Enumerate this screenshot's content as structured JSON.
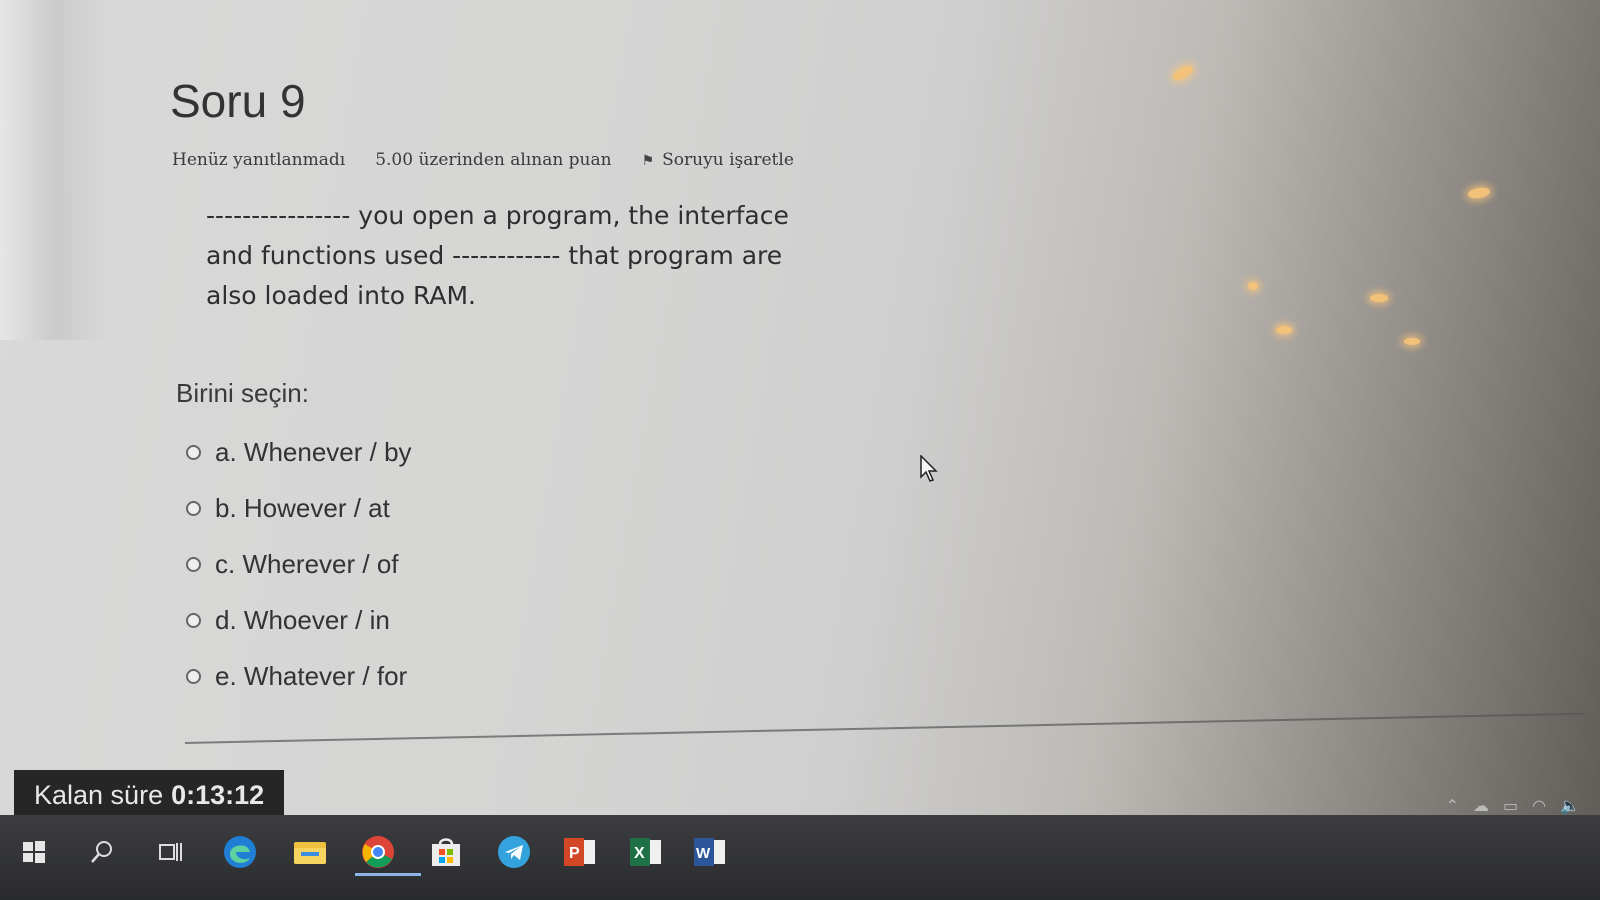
{
  "question": {
    "title": "Soru 9",
    "status": "Henüz yanıtlanmadı",
    "points": "5.00 üzerinden alınan puan",
    "flag_label": "Soruyu işaretle",
    "text": "---------------- you open a program, the interface and functions used ------------ that program are also loaded into RAM."
  },
  "answer": {
    "prompt": "Birini seçin:",
    "options": [
      {
        "label": "a. Whenever / by"
      },
      {
        "label": "b. However / at"
      },
      {
        "label": "c. Wherever / of"
      },
      {
        "label": "d. Whoever / in"
      },
      {
        "label": "e. Whatever / for"
      }
    ]
  },
  "timer": {
    "label": "Kalan süre",
    "value": "0:13:12"
  },
  "taskbar": {
    "icons": [
      "windows-start-icon",
      "search-icon",
      "task-view-icon",
      "edge-icon",
      "file-explorer-icon",
      "chrome-icon",
      "store-icon",
      "telegram-icon",
      "powerpoint-icon",
      "excel-icon",
      "word-icon"
    ]
  },
  "colors": {
    "screen_bg": "#d5d5d4",
    "text": "#333333",
    "timer_bg": "#262626",
    "taskbar_bg": "#2f3033"
  }
}
